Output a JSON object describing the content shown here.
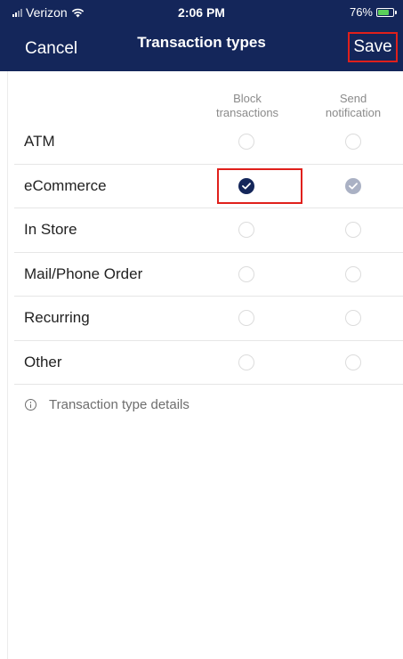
{
  "status_bar": {
    "carrier": "Verizon",
    "time": "2:06 PM",
    "battery": "76%",
    "battery_level": 0.76
  },
  "nav": {
    "cancel_label": "Cancel",
    "title": "Transaction types",
    "save_label": "Save"
  },
  "columns": {
    "block": "Block\ntransactions",
    "notify": "Send\nnotification"
  },
  "rows": [
    {
      "label": "ATM",
      "block": false,
      "notify": false
    },
    {
      "label": "eCommerce",
      "block": true,
      "notify": true
    },
    {
      "label": "In Store",
      "block": false,
      "notify": false
    },
    {
      "label": "Mail/Phone Order",
      "block": false,
      "notify": false
    },
    {
      "label": "Recurring",
      "block": false,
      "notify": false
    },
    {
      "label": "Other",
      "block": false,
      "notify": false
    }
  ],
  "details": {
    "label": "Transaction type details"
  },
  "colors": {
    "header_bg": "#14265a",
    "highlight": "#e0201b",
    "checked_block": "#14265a",
    "checked_notify": "#aab1c4"
  }
}
